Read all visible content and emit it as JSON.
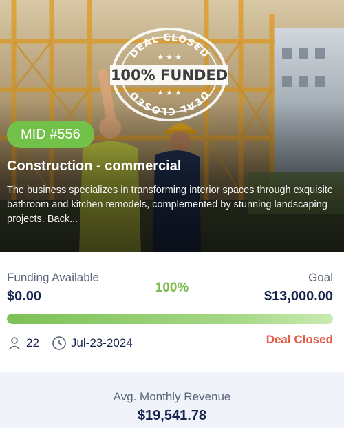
{
  "deal": {
    "mid_badge": "MID #556",
    "title": "Construction - commercial",
    "description": "The business specializes in transforming interior spaces through exquisite bathroom and kitchen remodels, complemented by stunning landscaping projects. Back...",
    "stamp": {
      "top_text": "DEAL CLOSED",
      "center_text": "100% FUNDED",
      "bottom_text": "DEAL CLOSED"
    }
  },
  "funding": {
    "available_label": "Funding Available",
    "available_value": "$0.00",
    "percent_label": "100%",
    "goal_label": "Goal",
    "goal_value": "$13,000.00",
    "progress_fraction": 1.0,
    "investors_count": "22",
    "date": "Jul-23-2024",
    "status": "Deal Closed"
  },
  "revenue": {
    "label": "Avg. Monthly Revenue",
    "value": "$19,541.78"
  },
  "icons": {
    "investors": "person-icon",
    "date": "clock-icon"
  },
  "colors": {
    "badge_green": "#72c24a",
    "percent_green": "#7dbb4f",
    "status_red": "#e35b45",
    "value_navy": "#16244d",
    "revenue_bg": "#f0f4fa"
  }
}
